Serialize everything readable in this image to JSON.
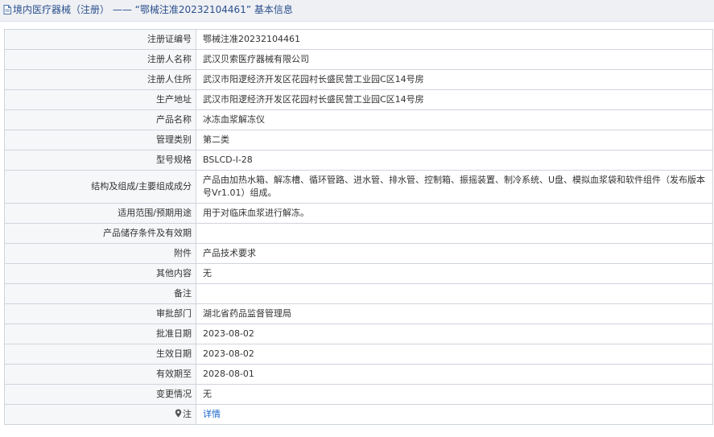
{
  "header": {
    "title": "境内医疗器械（注册） —— “鄂械注准20232104461” 基本信息"
  },
  "rows": [
    {
      "label": "注册证编号",
      "value": "鄂械注准20232104461"
    },
    {
      "label": "注册人名称",
      "value": "武汉贝索医疗器械有限公司"
    },
    {
      "label": "注册人住所",
      "value": "武汉市阳逻经济开发区花园村长盛民营工业园C区14号房"
    },
    {
      "label": "生产地址",
      "value": "武汉市阳逻经济开发区花园村长盛民营工业园C区14号房"
    },
    {
      "label": "产品名称",
      "value": "冰冻血浆解冻仪"
    },
    {
      "label": "管理类别",
      "value": "第二类"
    },
    {
      "label": "型号规格",
      "value": "BSLCD-I-28"
    },
    {
      "label": "结构及组成/主要组成成分",
      "value": "产品由加热水箱、解冻槽、循环管路、进水管、排水管、控制箱、振摇装置、制冷系统、U盘、模拟血浆袋和软件组件（发布版本号Vr1.01）组成。"
    },
    {
      "label": "适用范围/预期用途",
      "value": "用于对临床血浆进行解冻。"
    },
    {
      "label": "产品储存条件及有效期",
      "value": ""
    },
    {
      "label": "附件",
      "value": "产品技术要求"
    },
    {
      "label": "其他内容",
      "value": "无"
    },
    {
      "label": "备注",
      "value": ""
    },
    {
      "label": "审批部门",
      "value": "湖北省药品监督管理局"
    },
    {
      "label": "批准日期",
      "value": "2023-08-02"
    },
    {
      "label": "生效日期",
      "value": "2023-08-02"
    },
    {
      "label": "有效期至",
      "value": "2028-08-01"
    },
    {
      "label": "变更情况",
      "value": "无"
    }
  ],
  "note_row": {
    "label": "注",
    "link_text": "详情",
    "icon": "map-pin-icon"
  },
  "colors": {
    "title_text": "#2b4f8c",
    "link": "#1a66c8",
    "border": "#cfd4dc"
  }
}
